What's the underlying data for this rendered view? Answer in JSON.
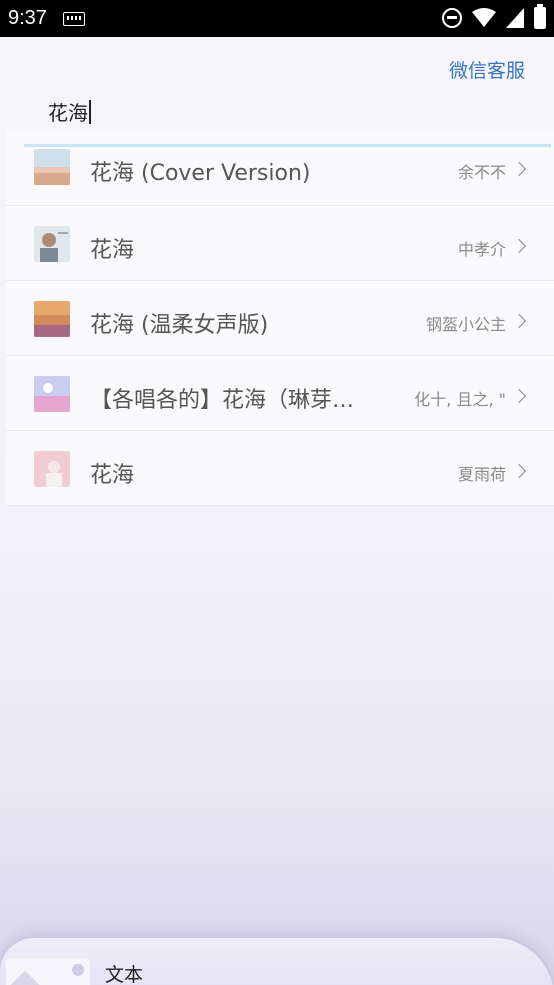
{
  "status_bar": {
    "time": "9:37"
  },
  "header": {
    "wechat_service_label": "微信客服"
  },
  "search": {
    "query": "花海"
  },
  "results": [
    {
      "title": "花海 (Cover Version)",
      "artist": "余不不"
    },
    {
      "title": "花海",
      "artist": "中孝介"
    },
    {
      "title": "花海 (温柔女声版)",
      "artist": "钢盔小公主"
    },
    {
      "title": "【各唱各的】花海（琳芽…",
      "artist": "化十, 且之, \""
    },
    {
      "title": "花海",
      "artist": "夏雨荷"
    }
  ],
  "bottom_bar": {
    "label": "文本"
  }
}
